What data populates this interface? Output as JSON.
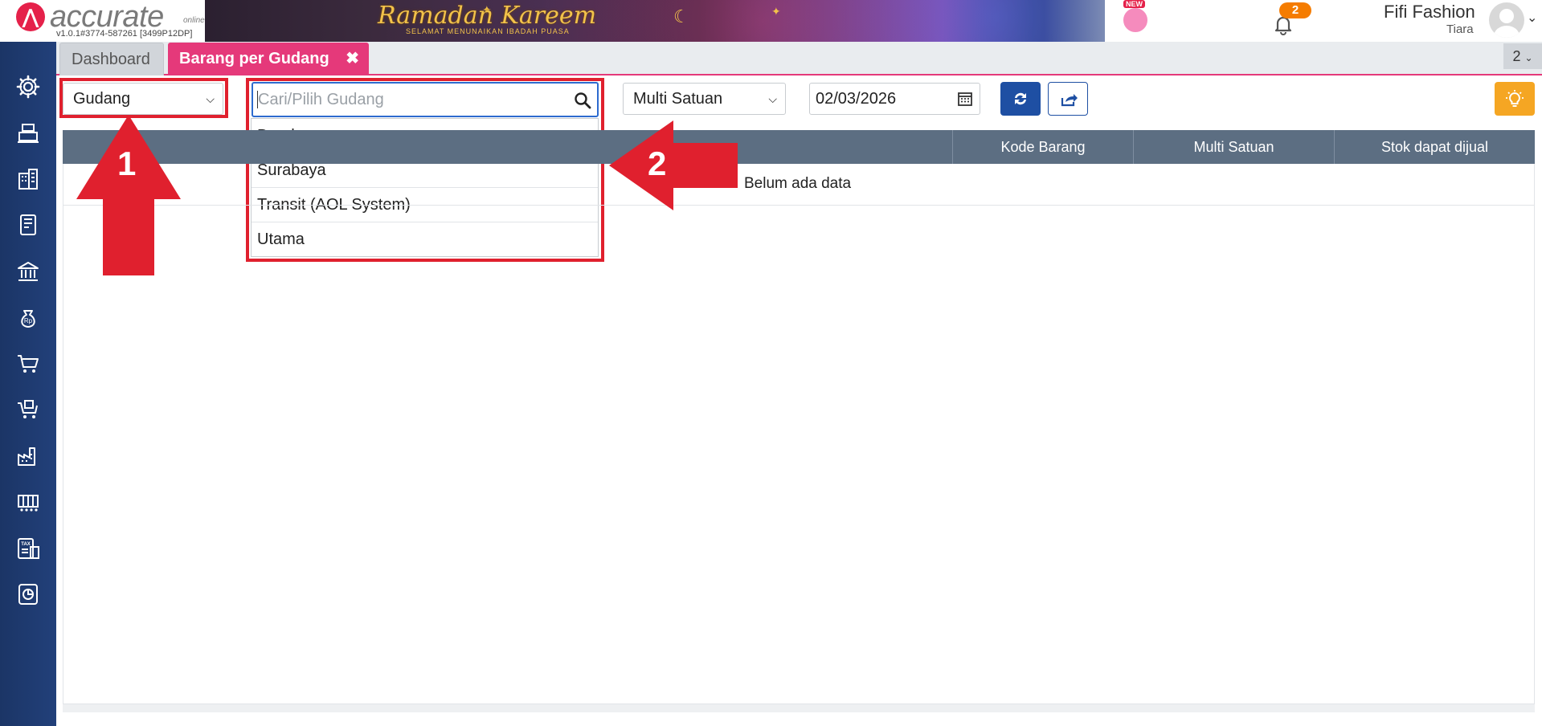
{
  "header": {
    "brand": "accurate",
    "brand_sub": "online",
    "version": "v1.0.1#3774-587261 [3499P12DP]",
    "banner_title": "Ramadan Kareem",
    "banner_subtitle": "SELAMAT MENUNAIKAN IBADAH PUASA",
    "new_badge": "NEW",
    "notification_count": "2",
    "company_name": "Fifi Fashion",
    "user_name": "Tiara"
  },
  "tabs": {
    "items": [
      {
        "label": "Dashboard"
      },
      {
        "label": "Barang per Gudang"
      }
    ],
    "close_glyph": "✖",
    "open_count": "2"
  },
  "filters": {
    "group_by": "Gudang",
    "search_placeholder": "Cari/Pilih Gudang",
    "unit_mode": "Multi Satuan",
    "date": "02/03/2026"
  },
  "dropdown": {
    "options": [
      "Bandung",
      "Surabaya",
      "Transit (AOL System)",
      "Utama"
    ]
  },
  "table": {
    "columns": [
      "Kode Barang",
      "Multi Satuan",
      "Stok dapat dijual"
    ],
    "empty_message": "Belum ada data"
  },
  "annotations": {
    "arrow_1": "1",
    "arrow_2": "2",
    "highlight_color": "#e0202e"
  },
  "colors": {
    "sidebar": "#1f3a6b",
    "active_tab": "#e5397a",
    "primary_button": "#1e4fa3",
    "tip_button": "#f5a623",
    "table_header": "#5c6e82"
  },
  "sidebar": {
    "icons": [
      "gear-icon",
      "cashier-icon",
      "building-icon",
      "ledger-icon",
      "bank-icon",
      "money-bag-icon",
      "cart-icon",
      "purchase-cart-icon",
      "factory-icon",
      "inventory-icon",
      "tax-icon",
      "report-icon"
    ]
  }
}
